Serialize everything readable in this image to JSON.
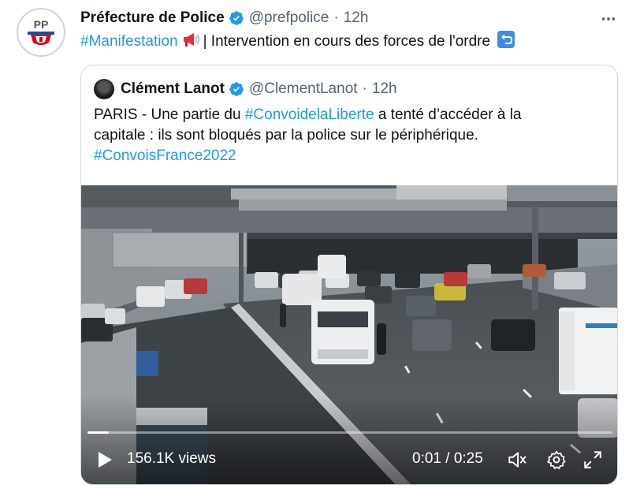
{
  "tweet": {
    "author_name": "Préfecture de Police",
    "author_handle": "@prefpolice",
    "separator": "·",
    "time": "12h",
    "hashtag": "#Manifestation",
    "text": "| Intervention en cours des forces de l'ordre"
  },
  "quoted": {
    "author_name": "Clément Lanot",
    "author_handle": "@ClementLanot",
    "separator": "·",
    "time": "12h",
    "line1_prefix": "PARIS - Une partie du ",
    "line1_hashtag": "#ConvoidelaLiberte",
    "line1_suffix": " a tenté d’accéder à la",
    "line2": "capitale : ils sont bloqués par la police sur le périphérique.",
    "line3_hashtag": "#ConvoisFrance2022"
  },
  "video": {
    "views": "156.1K views",
    "timecode": "0:01 / 0:25",
    "progress": 0.04
  },
  "icons": {
    "verified": "verified-badge-icon",
    "more": "more-icon",
    "megaphone": "megaphone-icon",
    "return": "return-arrow-icon",
    "play": "play-icon",
    "volume": "volume-icon",
    "settings": "gear-icon",
    "fullscreen": "fullscreen-icon"
  },
  "colors": {
    "accent": "#1d9bf0",
    "text": "#0f1419",
    "secondary": "#536471"
  }
}
